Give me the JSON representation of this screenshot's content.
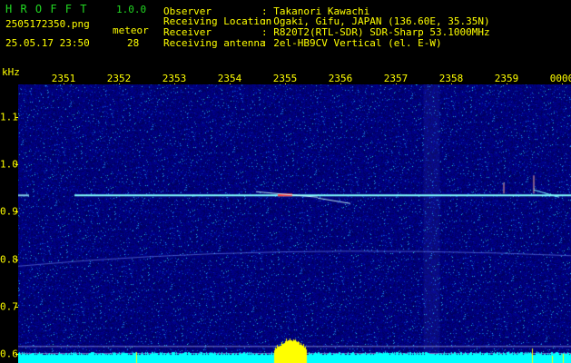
{
  "header": {
    "brand": "H R O F F T",
    "version": "1.0.0",
    "filename": "2505172350.png",
    "datetime": "25.05.17 23:50",
    "meteor_label": "meteor",
    "meteor_count": "28",
    "info": [
      {
        "key": "Observer",
        "value": ": Takanori Kawachi"
      },
      {
        "key": "Receiving Location",
        "value": ": Ogaki, Gifu, JAPAN (136.60E, 35.35N)"
      },
      {
        "key": "Receiver",
        "value": ": R820T2(RTL-SDR) SDR-Sharp 53.1000MHz"
      },
      {
        "key": "Receiving antenna",
        "value": ": 2el-HB9CV Vertical (el. E-W)"
      }
    ]
  },
  "chart_data": {
    "type": "heatmap",
    "ylabel": "kHz",
    "x_tick_labels": [
      "2351",
      "2352",
      "2353",
      "2354",
      "2355",
      "2356",
      "2357",
      "2358",
      "2359",
      "0000"
    ],
    "y_tick_labels": [
      "1.1",
      "1.0",
      "0.9",
      "0.8",
      "0.7",
      "0.6"
    ],
    "y_tick_values": [
      1.1,
      1.0,
      0.9,
      0.8,
      0.7,
      0.6
    ],
    "ylim": [
      0.58,
      1.17
    ],
    "carrier_freq_khz": 0.935,
    "drift_line_freq_khz": [
      0.785,
      0.815
    ],
    "colors": {
      "background": "#000080",
      "text": "#ffff00",
      "brand": "#22d822",
      "signal": "#80ffff",
      "meteor_head": "#ff4040",
      "activity_bar": "#ffff00",
      "bottom_band": "#00ffff"
    }
  }
}
